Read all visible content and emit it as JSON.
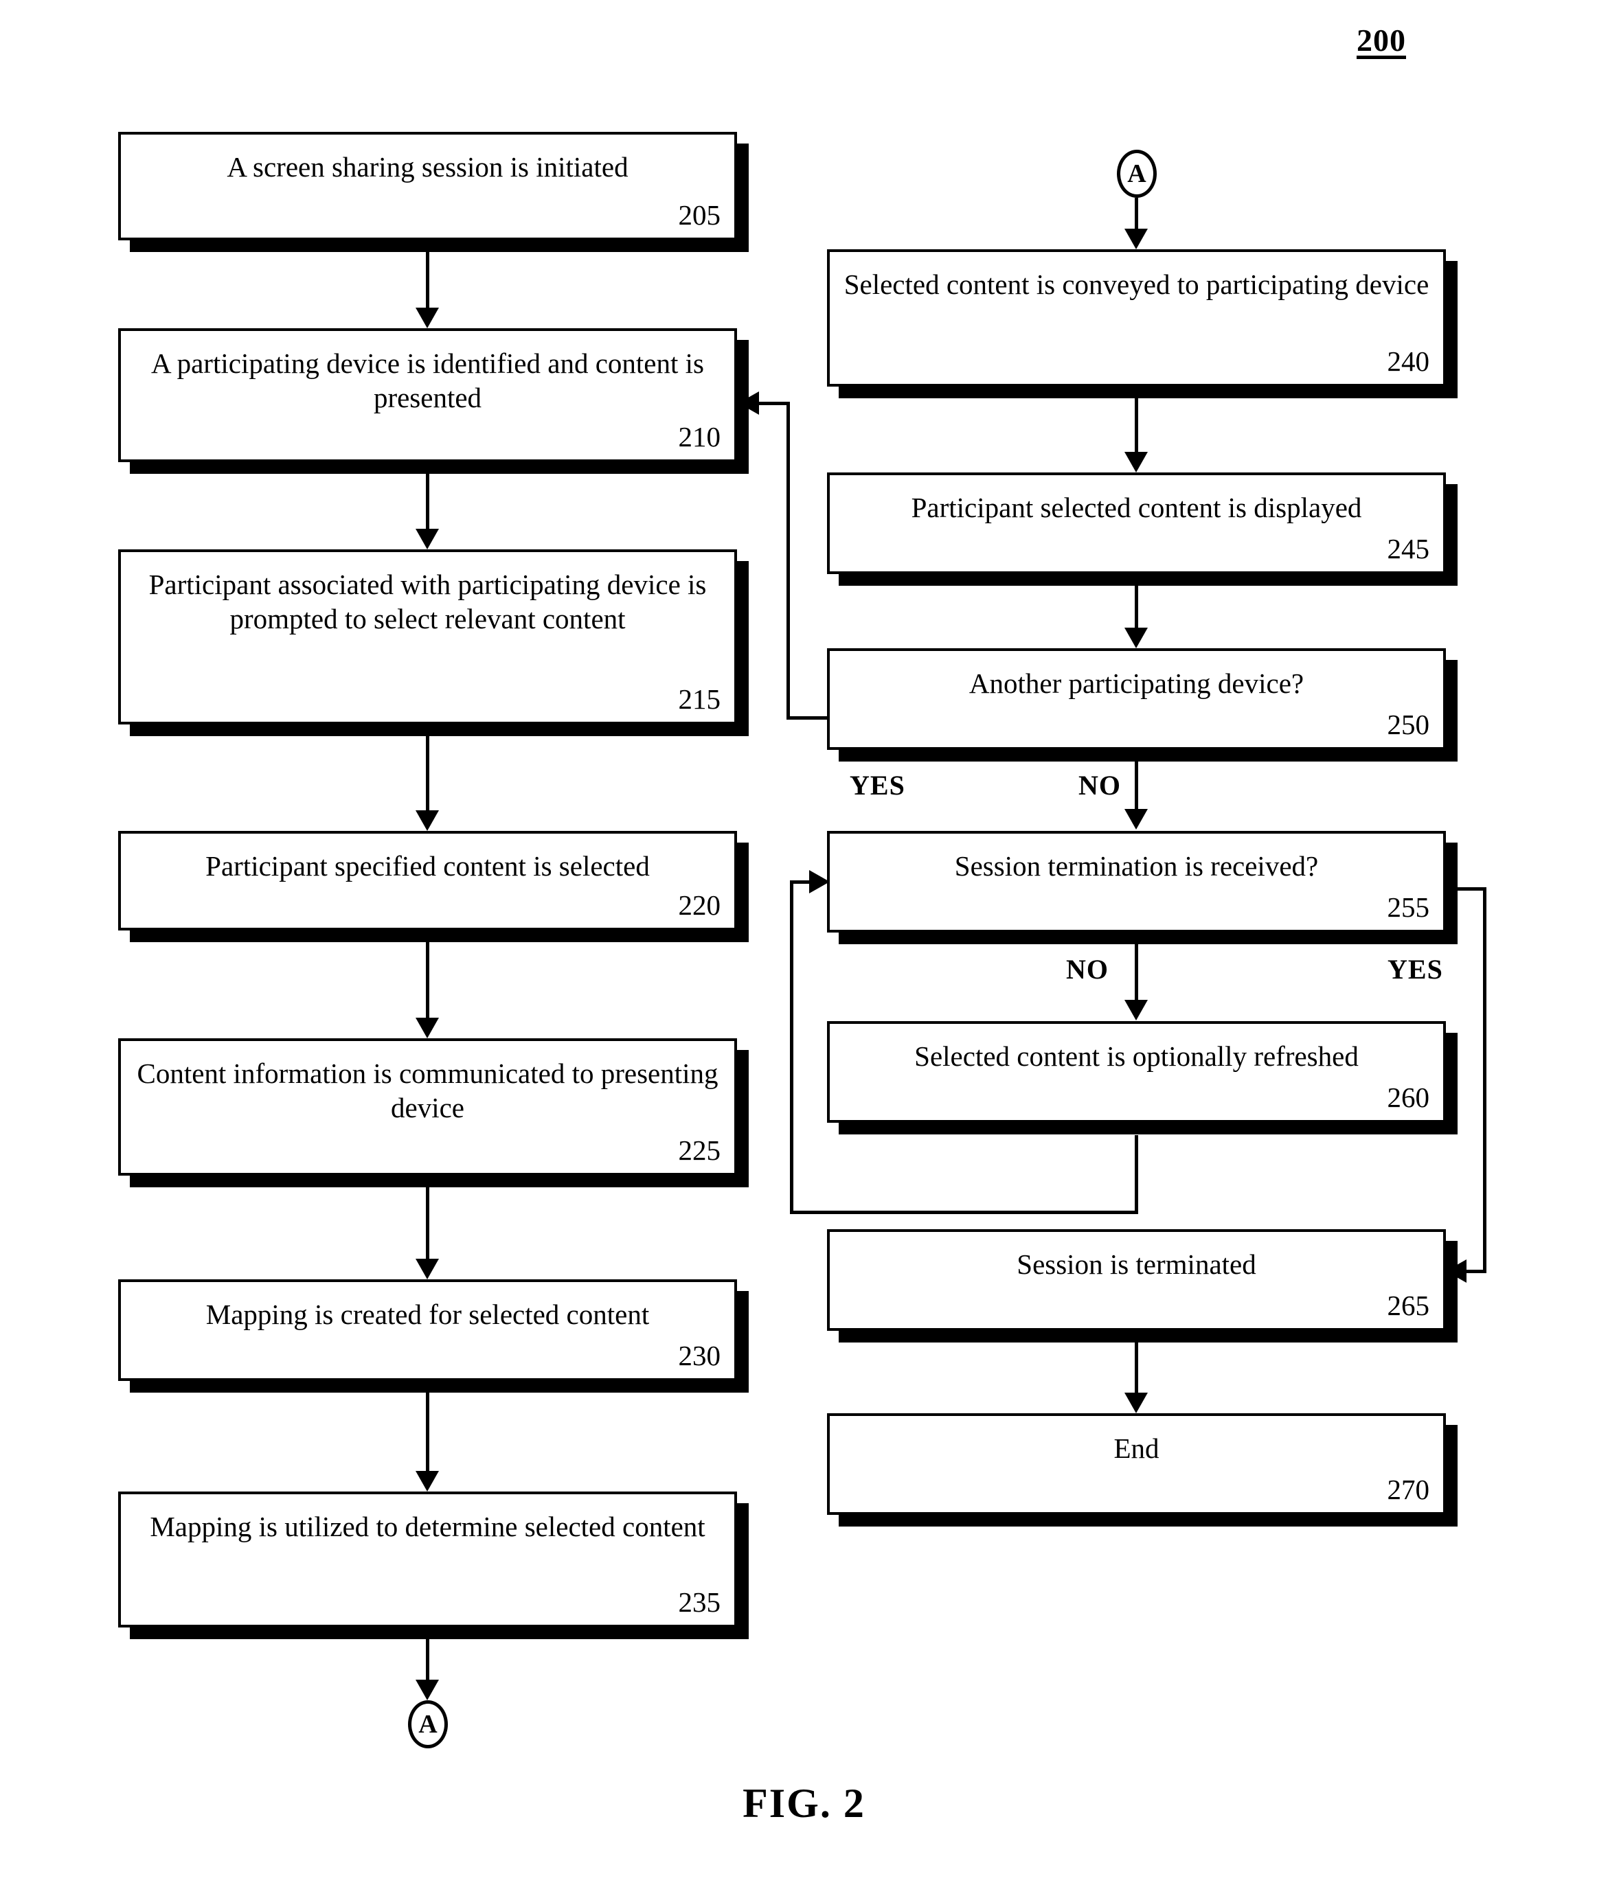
{
  "figure": {
    "number_label": "200",
    "caption": "FIG. 2"
  },
  "connectors": {
    "a_top": "A",
    "a_bottom": "A"
  },
  "branch_labels": {
    "d250_yes": "YES",
    "d250_no": "NO",
    "d255_no": "NO",
    "d255_yes": "YES"
  },
  "left_column": [
    {
      "id": "205",
      "text": "A screen sharing session is initiated",
      "number": "205"
    },
    {
      "id": "210",
      "text": "A participating device is identified and content is presented",
      "number": "210"
    },
    {
      "id": "215",
      "text": "Participant associated with participating device is prompted to select relevant content",
      "number": "215"
    },
    {
      "id": "220",
      "text": "Participant specified content is selected",
      "number": "220"
    },
    {
      "id": "225",
      "text": "Content information is communicated to presenting device",
      "number": "225"
    },
    {
      "id": "230",
      "text": "Mapping is created for selected content",
      "number": "230"
    },
    {
      "id": "235",
      "text": "Mapping is utilized to determine selected content",
      "number": "235"
    }
  ],
  "right_column": [
    {
      "id": "240",
      "text": "Selected content is conveyed to participating device",
      "number": "240"
    },
    {
      "id": "245",
      "text": "Participant selected content is displayed",
      "number": "245"
    },
    {
      "id": "250",
      "text": "Another participating device?",
      "number": "250"
    },
    {
      "id": "255",
      "text": "Session termination is received?",
      "number": "255"
    },
    {
      "id": "260",
      "text": "Selected content is optionally refreshed",
      "number": "260"
    },
    {
      "id": "265",
      "text": "Session is terminated",
      "number": "265"
    },
    {
      "id": "270",
      "text": "End",
      "number": "270"
    }
  ]
}
